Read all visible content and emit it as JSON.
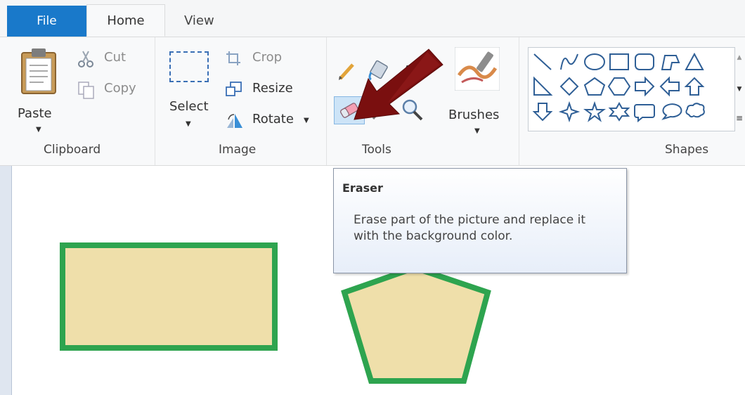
{
  "tabs": {
    "file": "File",
    "home": "Home",
    "view": "View"
  },
  "clipboard": {
    "group_label": "Clipboard",
    "paste_label": "Paste",
    "cut_label": "Cut",
    "copy_label": "Copy"
  },
  "image": {
    "group_label": "Image",
    "select_label": "Select",
    "crop_label": "Crop",
    "resize_label": "Resize",
    "rotate_label": "Rotate"
  },
  "tools": {
    "group_label": "Tools",
    "brushes_label": "Brushes",
    "selected_tool": "eraser-icon"
  },
  "shapes": {
    "group_label": "Shapes",
    "icons": [
      "line",
      "curve",
      "oval",
      "rectangle",
      "rounded-rectangle",
      "polygon",
      "triangle",
      "right-triangle",
      "diamond",
      "pentagon",
      "hexagon",
      "right-arrow",
      "left-arrow",
      "up-arrow",
      "down-arrow",
      "four-point-star",
      "five-point-star",
      "six-point-star",
      "rounded-callout",
      "oval-callout",
      "cloud-callout"
    ]
  },
  "tooltip": {
    "title": "Eraser",
    "body": "Erase part of the picture and replace it with the background color."
  },
  "colors": {
    "file_tab": "#1979ca",
    "shape_outline": "#2ea44f",
    "shape_fill": "#efdfaa",
    "annotation_arrow": "#7a0f0f"
  }
}
